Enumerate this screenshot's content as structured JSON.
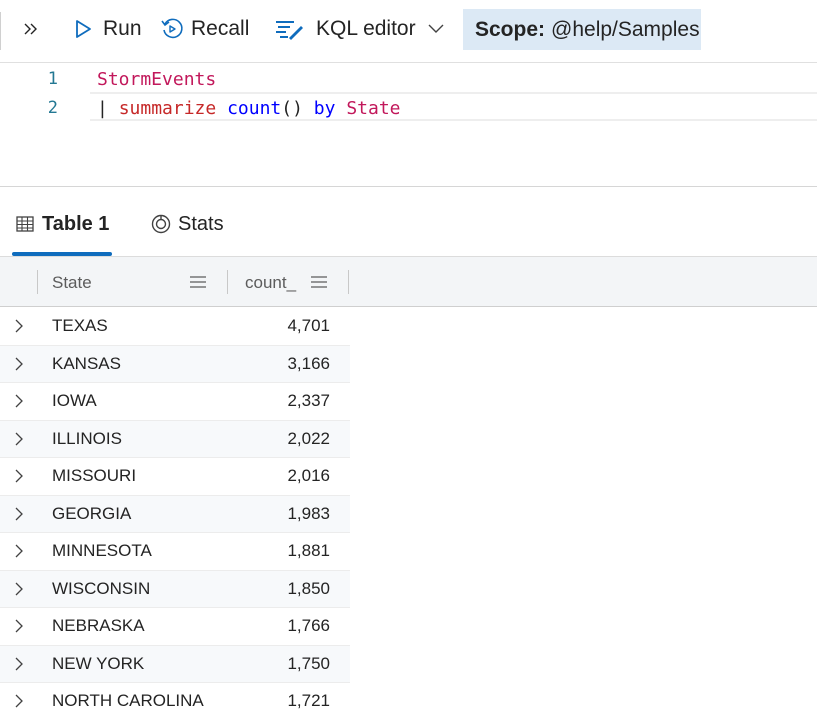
{
  "toolbar": {
    "expand_icon": "double-chevron-right-icon",
    "run_label": "Run",
    "run_icon": "play-icon",
    "recall_label": "Recall",
    "recall_icon": "recall-icon",
    "editor_label": "KQL editor",
    "editor_icon": "kql-editor-icon",
    "scope_label": "Scope:",
    "scope_value": "@help/Samples"
  },
  "editor": {
    "lines": [
      {
        "number": "1",
        "tokens": [
          "StormEvents"
        ]
      },
      {
        "number": "2",
        "tokens": [
          "|",
          "summarize",
          "count",
          "()",
          "by",
          "State"
        ]
      }
    ]
  },
  "tabs": [
    {
      "label": "Table 1",
      "icon": "table-icon",
      "active": true
    },
    {
      "label": "Stats",
      "icon": "stats-icon",
      "active": false
    }
  ],
  "grid": {
    "columns": [
      "State",
      "count_"
    ],
    "rows": [
      {
        "state": "TEXAS",
        "count": "4,701"
      },
      {
        "state": "KANSAS",
        "count": "3,166"
      },
      {
        "state": "IOWA",
        "count": "2,337"
      },
      {
        "state": "ILLINOIS",
        "count": "2,022"
      },
      {
        "state": "MISSOURI",
        "count": "2,016"
      },
      {
        "state": "GEORGIA",
        "count": "1,983"
      },
      {
        "state": "MINNESOTA",
        "count": "1,881"
      },
      {
        "state": "WISCONSIN",
        "count": "1,850"
      },
      {
        "state": "NEBRASKA",
        "count": "1,766"
      },
      {
        "state": "NEW YORK",
        "count": "1,750"
      },
      {
        "state": "NORTH CAROLINA",
        "count": "1,721"
      }
    ]
  },
  "colors": {
    "accent": "#0f6cbd",
    "scope_background": "#dce9f5",
    "table_name": "#c2185b",
    "operator": "#c62828",
    "keyword": "#0000ff"
  }
}
